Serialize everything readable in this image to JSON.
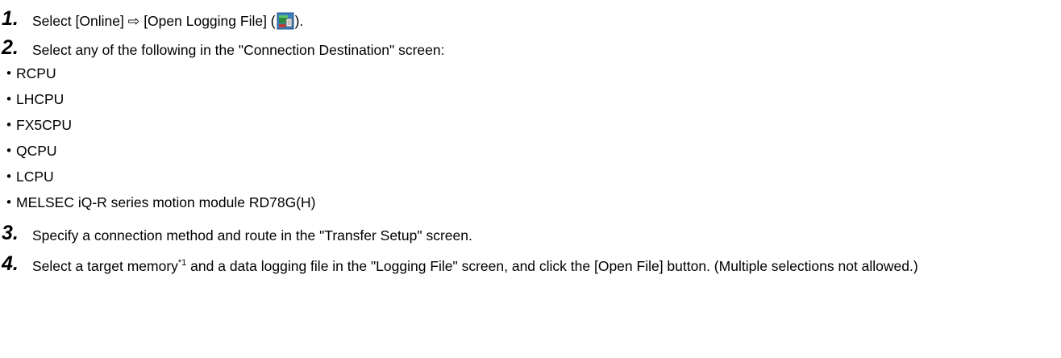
{
  "steps": [
    {
      "num": "1.",
      "pre": "Select [Online] ⇨ [Open Logging File] (",
      "icon": "logging-file-icon",
      "post": ")."
    },
    {
      "num": "2.",
      "text": "Select any of the following in the \"Connection Destination\" screen:"
    },
    {
      "num": "3.",
      "text": "Specify a connection method and route in the \"Transfer Setup\" screen."
    },
    {
      "num": "4.",
      "pre": "Select a target memory",
      "sup": "*1",
      "post": " and a data logging file in the \"Logging File\" screen, and click the [Open File] button. (Multiple selections not allowed.)"
    }
  ],
  "bullet_symbol": "・",
  "destinations": [
    "RCPU",
    "LHCPU",
    "FX5CPU",
    "QCPU",
    "LCPU",
    "MELSEC iQ-R series motion module RD78G(H)"
  ]
}
